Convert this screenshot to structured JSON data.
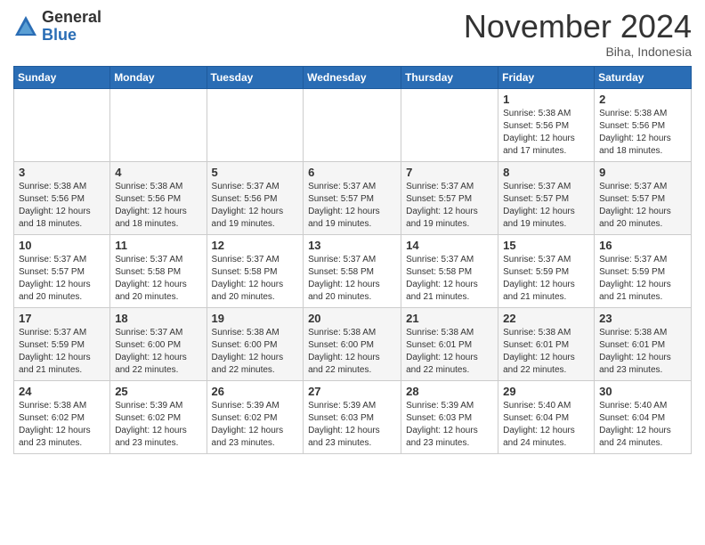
{
  "header": {
    "logo_general": "General",
    "logo_blue": "Blue",
    "month_title": "November 2024",
    "location": "Biha, Indonesia"
  },
  "days_of_week": [
    "Sunday",
    "Monday",
    "Tuesday",
    "Wednesday",
    "Thursday",
    "Friday",
    "Saturday"
  ],
  "weeks": [
    [
      {
        "day": "",
        "info": ""
      },
      {
        "day": "",
        "info": ""
      },
      {
        "day": "",
        "info": ""
      },
      {
        "day": "",
        "info": ""
      },
      {
        "day": "",
        "info": ""
      },
      {
        "day": "1",
        "info": "Sunrise: 5:38 AM\nSunset: 5:56 PM\nDaylight: 12 hours\nand 17 minutes."
      },
      {
        "day": "2",
        "info": "Sunrise: 5:38 AM\nSunset: 5:56 PM\nDaylight: 12 hours\nand 18 minutes."
      }
    ],
    [
      {
        "day": "3",
        "info": "Sunrise: 5:38 AM\nSunset: 5:56 PM\nDaylight: 12 hours\nand 18 minutes."
      },
      {
        "day": "4",
        "info": "Sunrise: 5:38 AM\nSunset: 5:56 PM\nDaylight: 12 hours\nand 18 minutes."
      },
      {
        "day": "5",
        "info": "Sunrise: 5:37 AM\nSunset: 5:56 PM\nDaylight: 12 hours\nand 19 minutes."
      },
      {
        "day": "6",
        "info": "Sunrise: 5:37 AM\nSunset: 5:57 PM\nDaylight: 12 hours\nand 19 minutes."
      },
      {
        "day": "7",
        "info": "Sunrise: 5:37 AM\nSunset: 5:57 PM\nDaylight: 12 hours\nand 19 minutes."
      },
      {
        "day": "8",
        "info": "Sunrise: 5:37 AM\nSunset: 5:57 PM\nDaylight: 12 hours\nand 19 minutes."
      },
      {
        "day": "9",
        "info": "Sunrise: 5:37 AM\nSunset: 5:57 PM\nDaylight: 12 hours\nand 20 minutes."
      }
    ],
    [
      {
        "day": "10",
        "info": "Sunrise: 5:37 AM\nSunset: 5:57 PM\nDaylight: 12 hours\nand 20 minutes."
      },
      {
        "day": "11",
        "info": "Sunrise: 5:37 AM\nSunset: 5:58 PM\nDaylight: 12 hours\nand 20 minutes."
      },
      {
        "day": "12",
        "info": "Sunrise: 5:37 AM\nSunset: 5:58 PM\nDaylight: 12 hours\nand 20 minutes."
      },
      {
        "day": "13",
        "info": "Sunrise: 5:37 AM\nSunset: 5:58 PM\nDaylight: 12 hours\nand 20 minutes."
      },
      {
        "day": "14",
        "info": "Sunrise: 5:37 AM\nSunset: 5:58 PM\nDaylight: 12 hours\nand 21 minutes."
      },
      {
        "day": "15",
        "info": "Sunrise: 5:37 AM\nSunset: 5:59 PM\nDaylight: 12 hours\nand 21 minutes."
      },
      {
        "day": "16",
        "info": "Sunrise: 5:37 AM\nSunset: 5:59 PM\nDaylight: 12 hours\nand 21 minutes."
      }
    ],
    [
      {
        "day": "17",
        "info": "Sunrise: 5:37 AM\nSunset: 5:59 PM\nDaylight: 12 hours\nand 21 minutes."
      },
      {
        "day": "18",
        "info": "Sunrise: 5:37 AM\nSunset: 6:00 PM\nDaylight: 12 hours\nand 22 minutes."
      },
      {
        "day": "19",
        "info": "Sunrise: 5:38 AM\nSunset: 6:00 PM\nDaylight: 12 hours\nand 22 minutes."
      },
      {
        "day": "20",
        "info": "Sunrise: 5:38 AM\nSunset: 6:00 PM\nDaylight: 12 hours\nand 22 minutes."
      },
      {
        "day": "21",
        "info": "Sunrise: 5:38 AM\nSunset: 6:01 PM\nDaylight: 12 hours\nand 22 minutes."
      },
      {
        "day": "22",
        "info": "Sunrise: 5:38 AM\nSunset: 6:01 PM\nDaylight: 12 hours\nand 22 minutes."
      },
      {
        "day": "23",
        "info": "Sunrise: 5:38 AM\nSunset: 6:01 PM\nDaylight: 12 hours\nand 23 minutes."
      }
    ],
    [
      {
        "day": "24",
        "info": "Sunrise: 5:38 AM\nSunset: 6:02 PM\nDaylight: 12 hours\nand 23 minutes."
      },
      {
        "day": "25",
        "info": "Sunrise: 5:39 AM\nSunset: 6:02 PM\nDaylight: 12 hours\nand 23 minutes."
      },
      {
        "day": "26",
        "info": "Sunrise: 5:39 AM\nSunset: 6:02 PM\nDaylight: 12 hours\nand 23 minutes."
      },
      {
        "day": "27",
        "info": "Sunrise: 5:39 AM\nSunset: 6:03 PM\nDaylight: 12 hours\nand 23 minutes."
      },
      {
        "day": "28",
        "info": "Sunrise: 5:39 AM\nSunset: 6:03 PM\nDaylight: 12 hours\nand 23 minutes."
      },
      {
        "day": "29",
        "info": "Sunrise: 5:40 AM\nSunset: 6:04 PM\nDaylight: 12 hours\nand 24 minutes."
      },
      {
        "day": "30",
        "info": "Sunrise: 5:40 AM\nSunset: 6:04 PM\nDaylight: 12 hours\nand 24 minutes."
      }
    ]
  ]
}
